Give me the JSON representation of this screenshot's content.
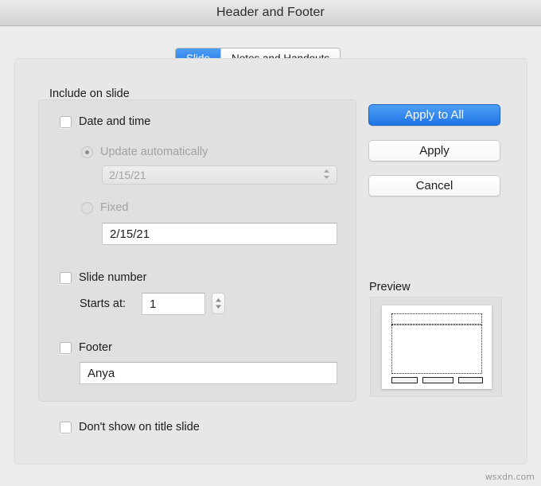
{
  "window": {
    "title": "Header and Footer"
  },
  "tabs": [
    {
      "label": "Slide",
      "selected": true
    },
    {
      "label": "Notes and Handouts",
      "selected": false
    }
  ],
  "include_on_slide": {
    "group_label": "Include on slide",
    "date_and_time": {
      "label": "Date and time",
      "checked": false,
      "update_automatically": {
        "label": "Update automatically",
        "selected": true,
        "enabled": false,
        "date_menu_value": "2/15/21",
        "date_menu_arrows": "chevron-up-down"
      },
      "fixed": {
        "label": "Fixed",
        "selected": false,
        "enabled": false,
        "value": "2/15/21",
        "placeholder": ""
      }
    },
    "slide_number": {
      "label": "Slide number",
      "checked": false,
      "starts_at_label": "Starts at:",
      "starts_at_value": "1",
      "stepper_up": "▲",
      "stepper_down": "▼"
    },
    "footer": {
      "label": "Footer",
      "checked": false,
      "value": "Anya",
      "placeholder": ""
    }
  },
  "dont_show_on_title_slide": {
    "label": "Don't show on title slide",
    "checked": false
  },
  "buttons": {
    "apply_to_all": "Apply to All",
    "apply": "Apply",
    "cancel": "Cancel"
  },
  "preview": {
    "label": "Preview"
  },
  "watermark": "wsxdn.com",
  "colors": {
    "accent_blue": "#1f75e6",
    "tab_selected_blue": "#1b73e8",
    "window_background": "#ececec",
    "group_background": "#e0e0e0",
    "panel_background": "#e7e7e7",
    "top_accent": "#4aa3ce"
  }
}
